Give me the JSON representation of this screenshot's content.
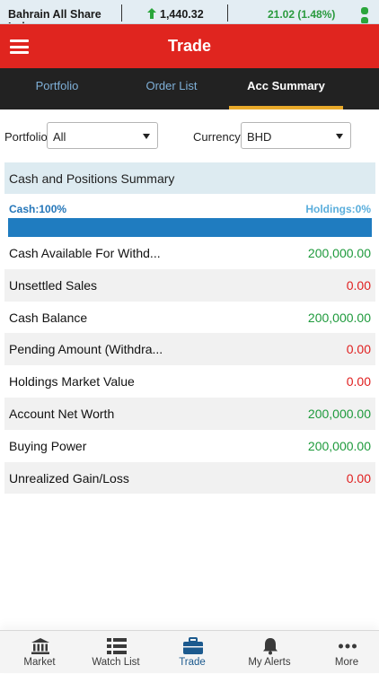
{
  "ticker": {
    "index_name": "Bahrain All Share Index",
    "index_value": "1,440.32",
    "change": "21.02 (1.48%)",
    "change_color": "#2a9a3e"
  },
  "appbar": {
    "title": "Trade",
    "menu_icon": "hamburger-menu-icon",
    "brand_color": "#e0251f"
  },
  "tabs": [
    {
      "label": "Portfolio",
      "active": false
    },
    {
      "label": "Order List",
      "active": false
    },
    {
      "label": "Acc Summary",
      "active": true
    }
  ],
  "filters": {
    "portfolio_label": "Portfolio",
    "portfolio_value": "All",
    "currency_label": "Currency",
    "currency_value": "BHD"
  },
  "summary": {
    "title": "Cash and Positions Summary",
    "cash_label": "Cash:100%",
    "holdings_label": "Holdings:0%",
    "cash_fraction": 1.0,
    "rows": [
      {
        "label": "Cash Available For Withd...",
        "value": "200,000.00",
        "color": "#1e9a3c"
      },
      {
        "label": "Unsettled Sales",
        "value": "0.00",
        "color": "#e01e1e"
      },
      {
        "label": "Cash Balance",
        "value": "200,000.00",
        "color": "#1e9a3c"
      },
      {
        "label": "Pending Amount (Withdra...",
        "value": "0.00",
        "color": "#e01e1e"
      },
      {
        "label": "Holdings Market Value",
        "value": "0.00",
        "color": "#e01e1e"
      },
      {
        "label": "Account Net Worth",
        "value": "200,000.00",
        "color": "#1e9a3c"
      },
      {
        "label": "Buying Power",
        "value": "200,000.00",
        "color": "#1e9a3c"
      },
      {
        "label": "Unrealized Gain/Loss",
        "value": "0.00",
        "color": "#e01e1e"
      }
    ]
  },
  "bottom_nav": [
    {
      "label": "Market",
      "icon": "bank-building-icon",
      "active": false
    },
    {
      "label": "Watch List",
      "icon": "list-icon",
      "active": false
    },
    {
      "label": "Trade",
      "icon": "briefcase-icon",
      "active": true
    },
    {
      "label": "My Alerts",
      "icon": "bell-icon",
      "active": false
    },
    {
      "label": "More",
      "icon": "more-dots-icon",
      "active": false
    }
  ]
}
